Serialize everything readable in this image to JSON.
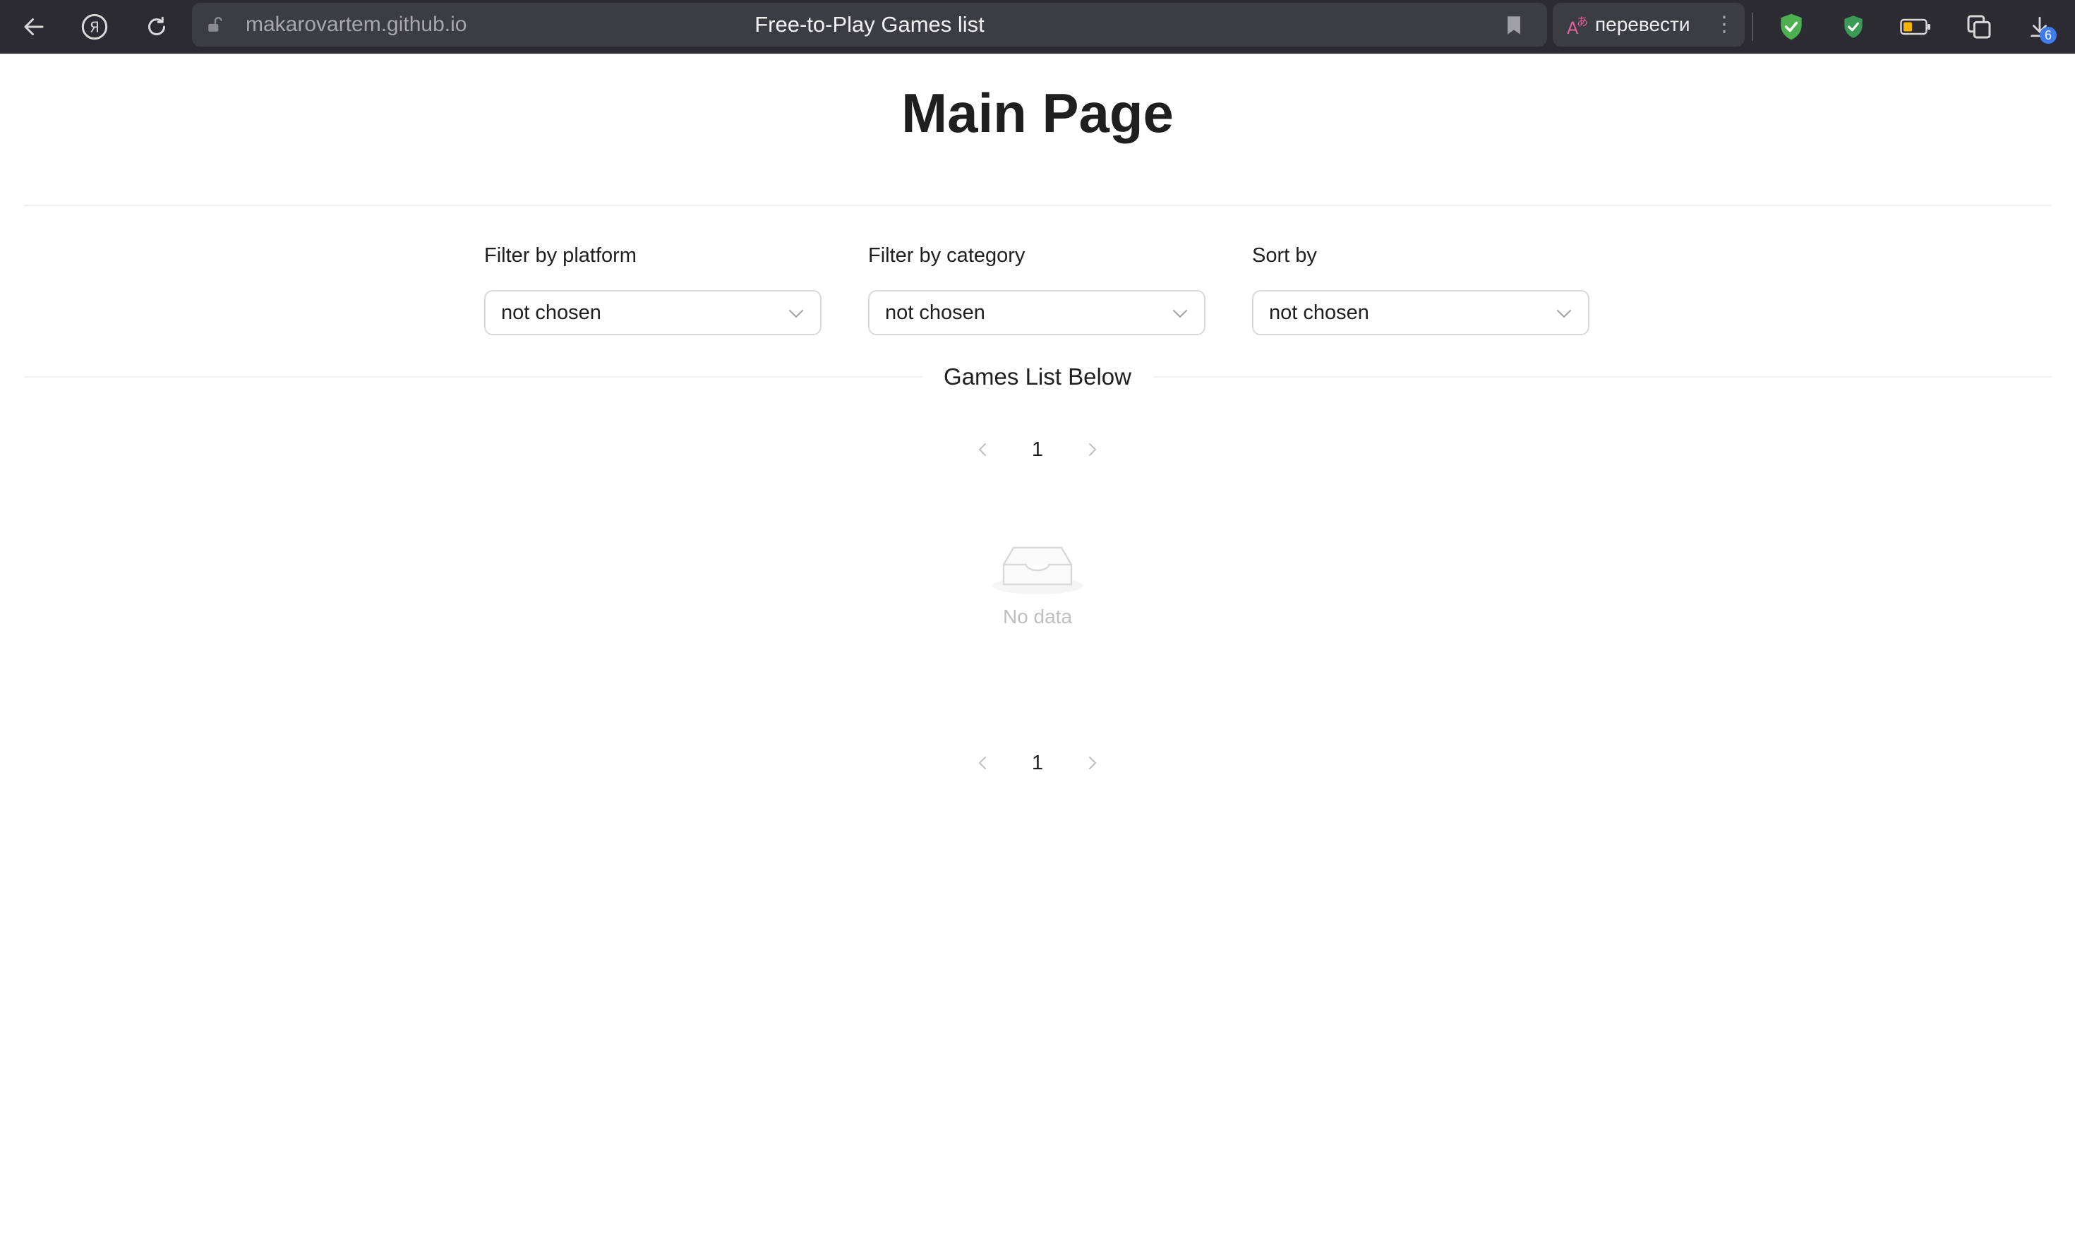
{
  "browser": {
    "url": "makarovartem.github.io",
    "tab_title": "Free-to-Play Games list",
    "translate_label": "перевести",
    "menu_dots": "⋮",
    "downloads_count": "6",
    "icons": [
      "back-icon",
      "yandex-icon",
      "reload-icon",
      "lock-icon",
      "bookmark-icon",
      "translate-icon",
      "shield-icon",
      "shield-check-icon",
      "battery-icon",
      "screenshot-icon",
      "download-icon"
    ]
  },
  "page": {
    "title": "Main Page",
    "filters": [
      {
        "label": "Filter by platform",
        "value": "not chosen"
      },
      {
        "label": "Filter by category",
        "value": "not chosen"
      },
      {
        "label": "Sort by",
        "value": "not chosen"
      }
    ],
    "list_heading": "Games List Below",
    "pagination_top": {
      "current_page": "1"
    },
    "pagination_bottom": {
      "current_page": "1"
    },
    "empty_text": "No data"
  },
  "colors": {
    "chrome_bg": "#2b2b31",
    "address_bg": "#3c3c43",
    "shield_green": "#4caf50",
    "badge_blue": "#3f7cf2",
    "border": "#d9d9d9"
  }
}
